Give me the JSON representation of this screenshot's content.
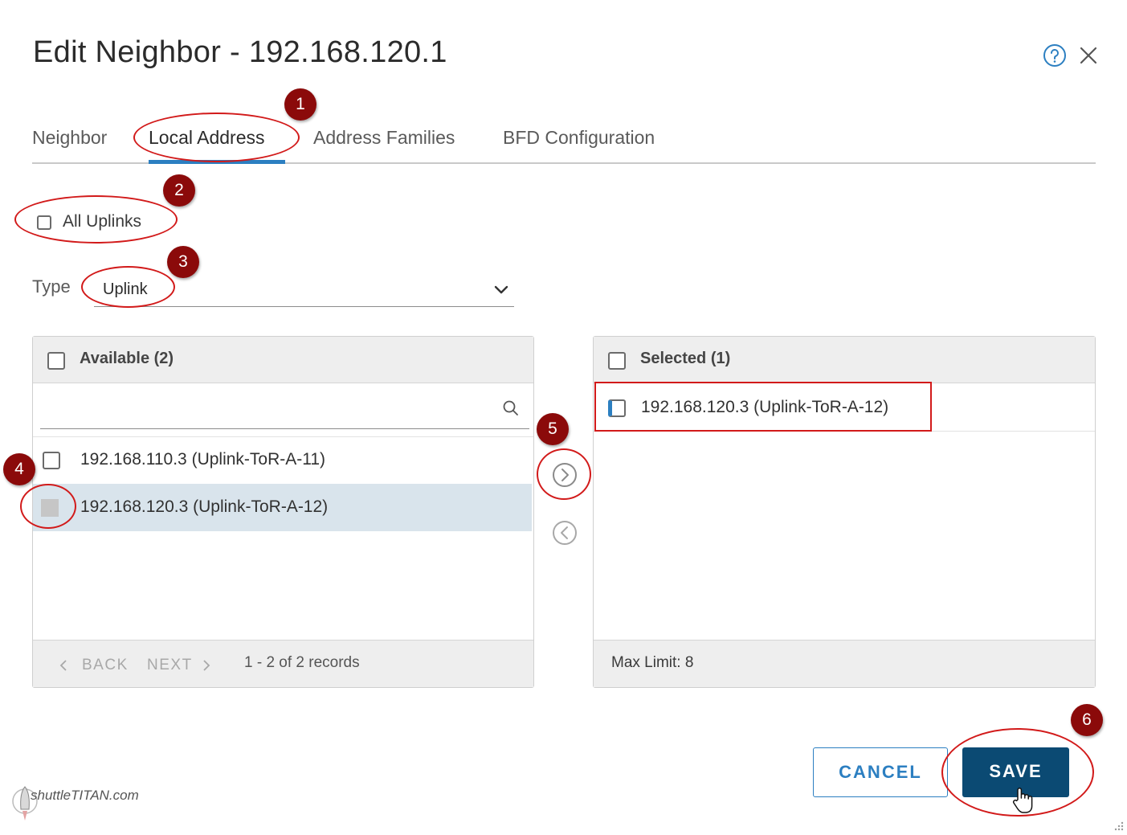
{
  "dialog": {
    "title": "Edit Neighbor - 192.168.120.1"
  },
  "tabs": [
    {
      "label": "Neighbor"
    },
    {
      "label": "Local Address"
    },
    {
      "label": "Address Families"
    },
    {
      "label": "BFD Configuration"
    }
  ],
  "all_uplinks": {
    "label": "All Uplinks",
    "checked": false
  },
  "type": {
    "label": "Type",
    "value": "Uplink"
  },
  "available": {
    "header": "Available (2)",
    "search_placeholder": "",
    "items": [
      {
        "label": "192.168.110.3 (Uplink-ToR-A-11)"
      },
      {
        "label": "192.168.120.3 (Uplink-ToR-A-12)"
      }
    ],
    "back_label": "BACK",
    "next_label": "NEXT",
    "records": "1 - 2 of 2 records"
  },
  "selected": {
    "header": "Selected (1)",
    "items": [
      {
        "label": "192.168.120.3 (Uplink-ToR-A-12)"
      }
    ],
    "max_limit": "Max Limit: 8"
  },
  "buttons": {
    "cancel": "CANCEL",
    "save": "SAVE"
  },
  "annotations": [
    "1",
    "2",
    "3",
    "4",
    "5",
    "6"
  ],
  "watermark": "shuttleTITAN.com",
  "colors": {
    "accent": "#2c7fc1",
    "save_bg": "#0b4a73",
    "annotation": "#8b0a0a",
    "highlight": "#d21a1a",
    "selected_row": "#d9e4ec"
  }
}
